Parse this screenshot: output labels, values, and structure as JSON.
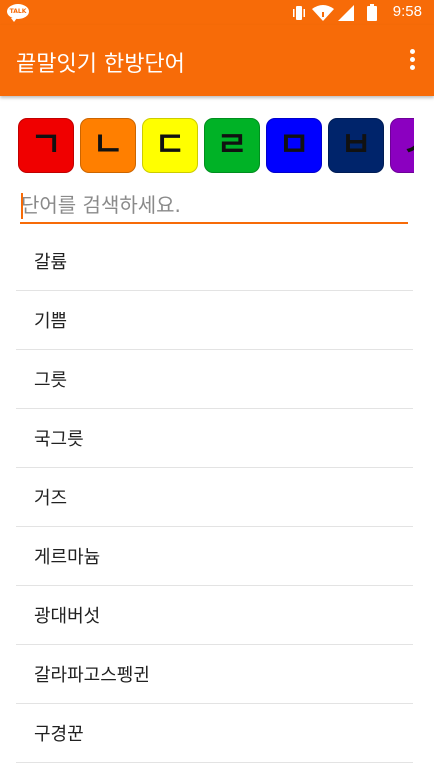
{
  "status_bar": {
    "time": "9:58",
    "talk_badge": "TALK",
    "icons": [
      "talk-icon",
      "vibrate-icon",
      "wifi-icon",
      "signal-icon",
      "battery-icon"
    ]
  },
  "app_bar": {
    "title": "끝말잇기 한방단어",
    "menu_icon": "overflow-menu-icon",
    "background": "#f76b08"
  },
  "consonants": [
    {
      "char": "ㄱ",
      "color": "#f00000"
    },
    {
      "char": "ㄴ",
      "color": "#ff7f00"
    },
    {
      "char": "ㄷ",
      "color": "#ffff00"
    },
    {
      "char": "ㄹ",
      "color": "#00b226"
    },
    {
      "char": "ㅁ",
      "color": "#0000ff"
    },
    {
      "char": "ㅂ",
      "color": "#00246b"
    },
    {
      "char": "ㅅ",
      "color": "#8b00c0"
    }
  ],
  "search": {
    "placeholder": "단어를 검색하세요.",
    "value": ""
  },
  "words": [
    "갈륨",
    "기쁨",
    "그릇",
    "국그릇",
    "거즈",
    "게르마늄",
    "광대버섯",
    "갈라파고스펭귄",
    "구경꾼"
  ]
}
